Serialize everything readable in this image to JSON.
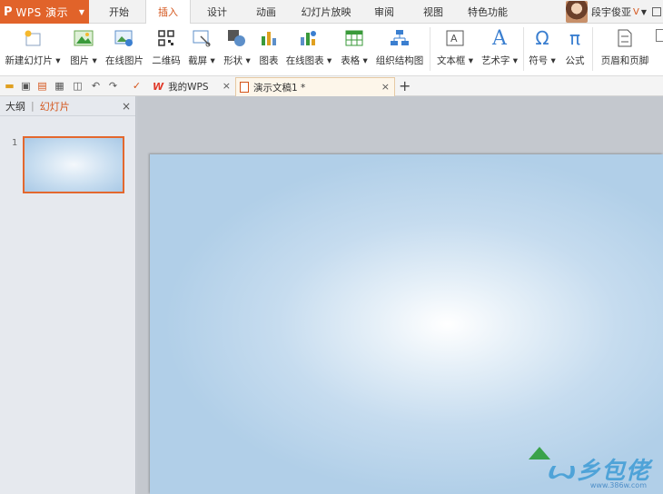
{
  "app": {
    "logo": "P",
    "name": "WPS 演示"
  },
  "menu": {
    "tabs": [
      {
        "label": "开始"
      },
      {
        "label": "插入"
      },
      {
        "label": "设计"
      },
      {
        "label": "动画"
      },
      {
        "label": "幻灯片放映"
      },
      {
        "label": "审阅"
      },
      {
        "label": "视图"
      },
      {
        "label": "特色功能"
      }
    ],
    "active": "插入"
  },
  "user": {
    "name": "段宇俊亚"
  },
  "ribbon": {
    "buttons": [
      {
        "label": "新建幻灯片 ▾",
        "icon": "new-slide-icon"
      },
      {
        "label": "图片 ▾",
        "icon": "picture-icon"
      },
      {
        "label": "在线图片",
        "icon": "online-picture-icon"
      },
      {
        "label": "二维码",
        "icon": "qrcode-icon"
      },
      {
        "label": "截屏 ▾",
        "icon": "screenshot-icon"
      },
      {
        "label": "形状 ▾",
        "icon": "shape-icon"
      },
      {
        "label": "图表",
        "icon": "chart-icon"
      },
      {
        "label": "在线图表 ▾",
        "icon": "online-chart-icon"
      },
      {
        "label": "表格 ▾",
        "icon": "table-icon"
      },
      {
        "label": "组织结构图",
        "icon": "org-chart-icon"
      },
      {
        "label": "文本框 ▾",
        "icon": "textbox-icon"
      },
      {
        "label": "艺术字 ▾",
        "icon": "wordart-icon"
      },
      {
        "label": "符号 ▾",
        "icon": "symbol-icon"
      },
      {
        "label": "公式",
        "icon": "formula-icon"
      },
      {
        "label": "页眉和页脚",
        "icon": "header-footer-icon"
      }
    ],
    "symbol_glyph": "Ω",
    "formula_glyph": "π",
    "wordart_glyph": "A"
  },
  "quickbar": {
    "tabs": [
      {
        "label": "我的WPS",
        "logo": "W"
      },
      {
        "label": "演示文稿1 *"
      }
    ],
    "close": "×",
    "add": "+"
  },
  "left_pane": {
    "tab_outline": "大纲",
    "tab_slides": "幻灯片",
    "close": "×",
    "slide_number": "1"
  },
  "watermark": {
    "text": "ꙍ乡包佬",
    "url": "www.386w.com"
  },
  "colors": {
    "accent": "#e1632a",
    "active_tab_text": "#d4541a",
    "slide_blue": "#b1cfe8"
  }
}
